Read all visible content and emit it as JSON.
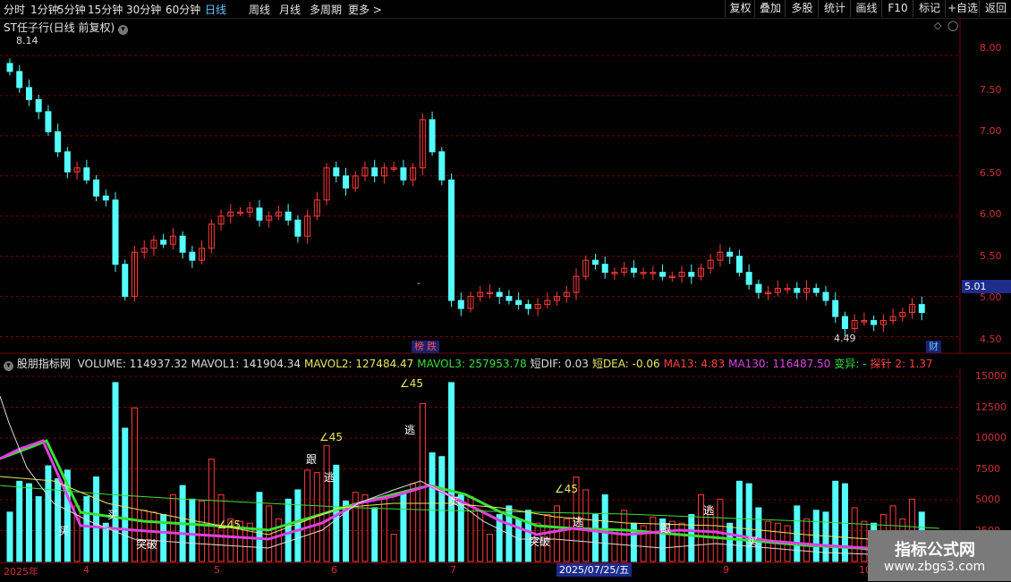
{
  "toolbar": {
    "periods": [
      "分时",
      "1分钟",
      "5分钟",
      "15分钟",
      "30分钟",
      "60分钟",
      "日线",
      "周线",
      "月线",
      "多周期",
      "更多 >"
    ],
    "active_period": "日线",
    "buttons": [
      "复权",
      "叠加",
      "多股",
      "统计",
      "画线",
      "F10",
      "标记",
      "+自选",
      "返回"
    ]
  },
  "stock": {
    "title": "ST任子行(日线 前复权)",
    "high_label": "8.14",
    "low_label": "4.49",
    "current_price": "5.01",
    "tag_bang": "榜",
    "tag_die": "跌",
    "tag_cai": "财",
    "dash": "-"
  },
  "price_axis": [
    "8.00",
    "7.50",
    "7.00",
    "6.50",
    "6.00",
    "5.50",
    "5.00",
    "4.50"
  ],
  "indicator": {
    "name": "股朋指标网",
    "fields": [
      {
        "text": "VOLUME: 114937.32",
        "color": "#dcdcdc"
      },
      {
        "text": "MAVOL1: 141904.34",
        "color": "#dcdcdc"
      },
      {
        "text": "MAVOL2: 127484.47",
        "color": "#e8e860"
      },
      {
        "text": "MAVOL3: 257953.78",
        "color": "#38e038"
      },
      {
        "text": "短DIF: 0.03",
        "color": "#dcdcdc"
      },
      {
        "text": "短DEA: -0.06",
        "color": "#e8e860"
      },
      {
        "text": "MA13: 4.83",
        "color": "#ff4040"
      },
      {
        "text": "MA130: 116487.50",
        "color": "#e040e0"
      },
      {
        "text": "变异: -",
        "color": "#38e038"
      },
      {
        "text": "探针 2: 1.37",
        "color": "#ff4040"
      }
    ]
  },
  "volume_axis": [
    "15000",
    "12500",
    "10000",
    "7500",
    "5000",
    "2500"
  ],
  "signals": {
    "angle45": "∠45",
    "flee": "逃",
    "follow": "跟",
    "buy": "买",
    "breakout": "突破",
    "tag_yi": "艺",
    "tag_jian": "减"
  },
  "x_axis": {
    "labels": [
      "2025年",
      "4",
      "5",
      "6",
      "7",
      "9",
      "10"
    ],
    "highlighted_date": "2025/07/25/五"
  },
  "watermark": {
    "line1": "指标公式网",
    "line2": "www.zbgs3.com"
  },
  "colors": {
    "up": "#ff3a3a",
    "down": "#54fcfc",
    "grid": "#7a0000",
    "active": "#5ec8ff",
    "accent_green": "#38e038",
    "accent_magenta": "#e040e0"
  },
  "chart_data": {
    "type": "candlestick",
    "price_candles_close_approx": [
      7.8,
      7.6,
      7.45,
      7.3,
      7.05,
      6.8,
      6.55,
      6.6,
      6.45,
      6.25,
      6.2,
      5.4,
      5.0,
      5.55,
      5.6,
      5.7,
      5.65,
      5.75,
      5.55,
      5.45,
      5.6,
      5.9,
      6.0,
      6.05,
      6.05,
      6.1,
      5.95,
      6.0,
      6.05,
      5.95,
      5.75,
      6.0,
      6.2,
      6.6,
      6.5,
      6.35,
      6.5,
      6.6,
      6.5,
      6.6,
      6.6,
      6.45,
      6.6,
      7.2,
      6.8,
      6.45,
      4.95,
      4.85,
      5.0,
      5.05,
      5.05,
      5.0,
      4.95,
      4.9,
      4.85,
      4.9,
      4.95,
      5.0,
      5.05,
      5.25,
      5.45,
      5.4,
      5.3,
      5.3,
      5.35,
      5.3,
      5.3,
      5.3,
      5.25,
      5.25,
      5.3,
      5.25,
      5.35,
      5.45,
      5.55,
      5.5,
      5.3,
      5.15,
      5.05,
      5.05,
      5.1,
      5.1,
      5.05,
      5.1,
      5.05,
      4.95,
      4.75,
      4.6,
      4.7,
      4.7,
      4.65,
      4.7,
      4.75,
      4.8,
      4.9,
      4.8
    ],
    "volume_axis_max": 15000,
    "marked_values": {
      "high": 8.14,
      "low": 4.49,
      "current": 5.01
    }
  }
}
